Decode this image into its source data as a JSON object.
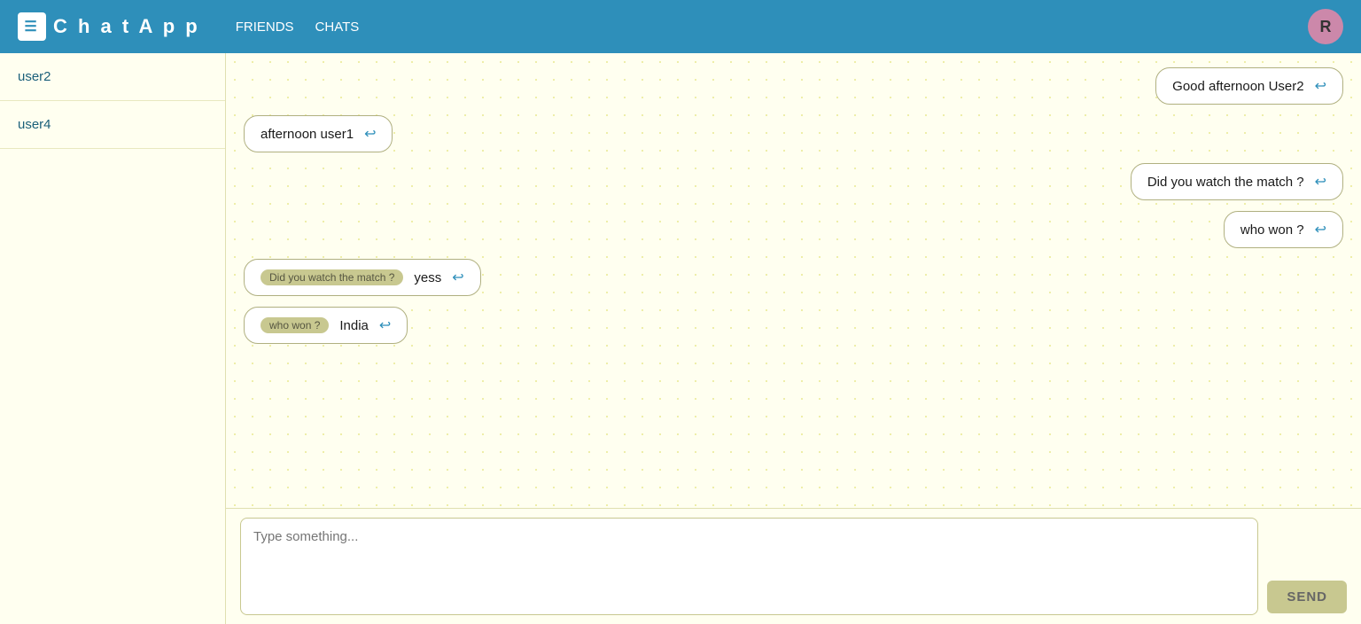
{
  "navbar": {
    "brand_icon": "☰",
    "brand_text": "C h a t   A p p",
    "links": [
      {
        "id": "friends",
        "label": "FRIENDS"
      },
      {
        "id": "chats",
        "label": "CHATS"
      }
    ],
    "avatar_letter": "R"
  },
  "sidebar": {
    "items": [
      {
        "id": "user2",
        "label": "user2"
      },
      {
        "id": "user4",
        "label": "user4"
      }
    ]
  },
  "chat": {
    "messages": [
      {
        "id": "msg1",
        "direction": "right",
        "text": "Good afternoon User2",
        "reply_ref": null,
        "reply_icon": "↩"
      },
      {
        "id": "msg2",
        "direction": "left",
        "text": "afternoon user1",
        "reply_ref": null,
        "reply_icon": "↩"
      },
      {
        "id": "msg3",
        "direction": "right",
        "text": "Did you watch the match ?",
        "reply_ref": null,
        "reply_icon": "↩"
      },
      {
        "id": "msg4",
        "direction": "right",
        "text": "who won ?",
        "reply_ref": null,
        "reply_icon": "↩"
      },
      {
        "id": "msg5",
        "direction": "left",
        "text": "yess",
        "reply_ref": "Did you watch the match ?",
        "reply_icon": "↩"
      },
      {
        "id": "msg6",
        "direction": "left",
        "text": "India",
        "reply_ref": "who won ?",
        "reply_icon": "↩"
      }
    ],
    "input_placeholder": "Type something...",
    "send_label": "SEND"
  }
}
